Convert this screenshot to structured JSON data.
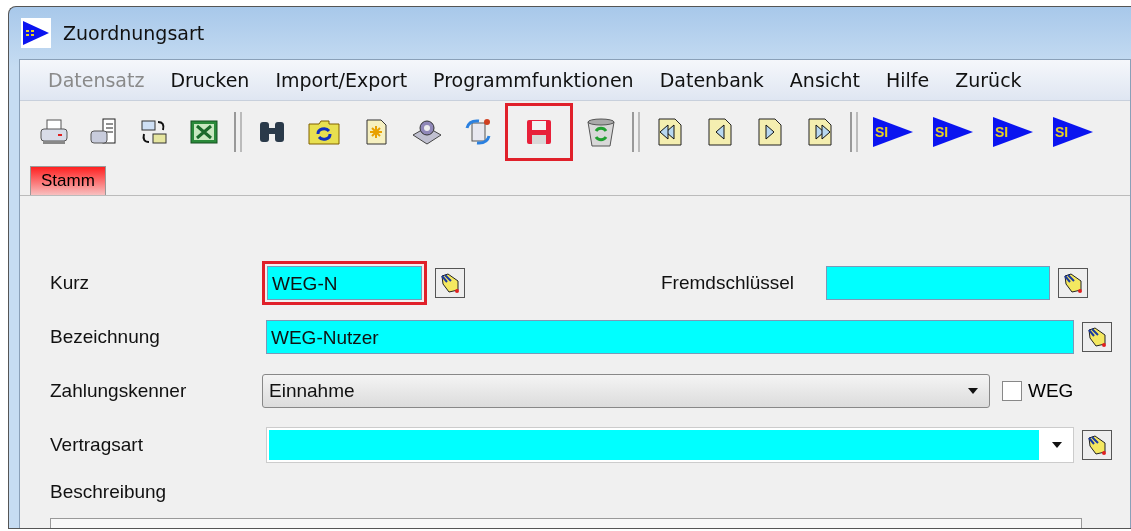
{
  "window": {
    "title": "Zuordnungsart"
  },
  "menu": [
    {
      "label": "Datensatz",
      "disabled": true
    },
    {
      "label": "Drucken",
      "disabled": false
    },
    {
      "label": "Import/Export",
      "disabled": false
    },
    {
      "label": "Programmfunktionen",
      "disabled": false
    },
    {
      "label": "Datenbank",
      "disabled": false
    },
    {
      "label": "Ansicht",
      "disabled": false
    },
    {
      "label": "Hilfe",
      "disabled": false
    },
    {
      "label": "Zurück",
      "disabled": false
    }
  ],
  "toolbar": [
    {
      "kind": "printer",
      "highlighted": false
    },
    {
      "kind": "print-preview",
      "highlighted": false
    },
    {
      "kind": "mail",
      "highlighted": false
    },
    {
      "kind": "sheet",
      "highlighted": false
    },
    {
      "kind": "separator"
    },
    {
      "kind": "binoculars",
      "highlighted": false
    },
    {
      "kind": "folder",
      "highlighted": false
    },
    {
      "kind": "new",
      "highlighted": false
    },
    {
      "kind": "gear",
      "highlighted": false
    },
    {
      "kind": "refresh",
      "highlighted": false
    },
    {
      "kind": "save",
      "highlighted": true
    },
    {
      "kind": "trash",
      "highlighted": false
    },
    {
      "kind": "separator"
    },
    {
      "kind": "first",
      "highlighted": false
    },
    {
      "kind": "prev",
      "highlighted": false
    },
    {
      "kind": "next",
      "highlighted": false
    },
    {
      "kind": "last",
      "highlighted": false
    },
    {
      "kind": "separator"
    },
    {
      "kind": "si",
      "text": "SI",
      "highlighted": false
    },
    {
      "kind": "si",
      "text": "SI",
      "highlighted": false
    },
    {
      "kind": "si",
      "text": "SI",
      "highlighted": false
    },
    {
      "kind": "si",
      "text": "SI",
      "highlighted": false
    }
  ],
  "tabs": [
    {
      "label": "Stamm",
      "selected": true
    }
  ],
  "form": {
    "kurz": {
      "label": "Kurz",
      "value": "WEG-N",
      "highlighted": true
    },
    "fremdschluessel": {
      "label": "Fremdschlüssel"
    },
    "bezeichnung": {
      "label": "Bezeichnung",
      "value": "WEG-Nutzer"
    },
    "zahlungskenner": {
      "label": "Zahlungskenner",
      "value": "Einnahme"
    },
    "weg": {
      "label": "WEG",
      "checked": false
    },
    "vertragsart": {
      "label": "Vertragsart"
    },
    "beschreibung": {
      "label": "Beschreibung"
    }
  }
}
